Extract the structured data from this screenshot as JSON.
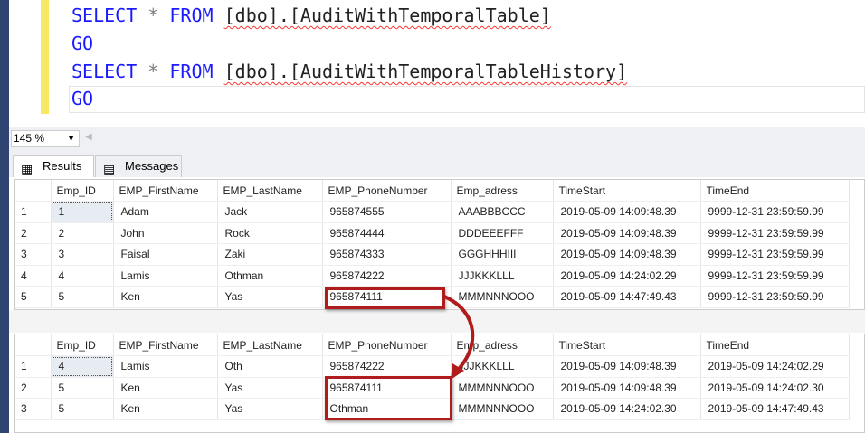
{
  "editor": {
    "lines": [
      {
        "kw1": "SELECT",
        "star": "*",
        "kw2": "FROM",
        "obj": "[dbo].[AuditWithTemporalTable]"
      },
      {
        "kw1": "GO"
      },
      {
        "kw1": "SELECT",
        "star": "*",
        "kw2": "FROM",
        "obj": "[dbo].[AuditWithTemporalTableHistory]"
      },
      {
        "kw1": "GO"
      }
    ]
  },
  "zoom": {
    "value": "145 %"
  },
  "tabs": [
    {
      "label": "Results",
      "icon": "grid-icon"
    },
    {
      "label": "Messages",
      "icon": "messages-icon"
    }
  ],
  "columns": [
    "",
    "Emp_ID",
    "EMP_FirstName",
    "EMP_LastName",
    "EMP_PhoneNumber",
    "Emp_adress",
    "TimeStart",
    "TimeEnd"
  ],
  "grid1": [
    [
      "1",
      "1",
      "Adam",
      "Jack",
      "965874555",
      "AAABBBCCC",
      "2019-05-09 14:09:48.39",
      "9999-12-31 23:59:59.99"
    ],
    [
      "2",
      "2",
      "John",
      "Rock",
      "965874444",
      "DDDEEEFFF",
      "2019-05-09 14:09:48.39",
      "9999-12-31 23:59:59.99"
    ],
    [
      "3",
      "3",
      "Faisal",
      "Zaki",
      "965874333",
      "GGGHHHIII",
      "2019-05-09 14:09:48.39",
      "9999-12-31 23:59:59.99"
    ],
    [
      "4",
      "4",
      "Lamis",
      "Othman",
      "965874222",
      "JJJKKKLLL",
      "2019-05-09 14:24:02.29",
      "9999-12-31 23:59:59.99"
    ],
    [
      "5",
      "5",
      "Ken",
      "Yas",
      "965874111",
      "MMMNNNOOO",
      "2019-05-09 14:47:49.43",
      "9999-12-31 23:59:59.99"
    ]
  ],
  "grid2": [
    [
      "1",
      "4",
      "Lamis",
      "Oth",
      "965874222",
      "JJJKKKLLL",
      "2019-05-09 14:09:48.39",
      "2019-05-09 14:24:02.29"
    ],
    [
      "2",
      "5",
      "Ken",
      "Yas",
      "965874111",
      "MMMNNNOOO",
      "2019-05-09 14:09:48.39",
      "2019-05-09 14:24:02.30"
    ],
    [
      "3",
      "5",
      "Ken",
      "Yas",
      "Othman",
      "MMMNNNOOO",
      "2019-05-09 14:24:02.30",
      "2019-05-09 14:47:49.43"
    ]
  ],
  "colors": {
    "keyword": "#1a1aff",
    "highlight": "#b01c1c",
    "gutter": "#f7e964"
  }
}
